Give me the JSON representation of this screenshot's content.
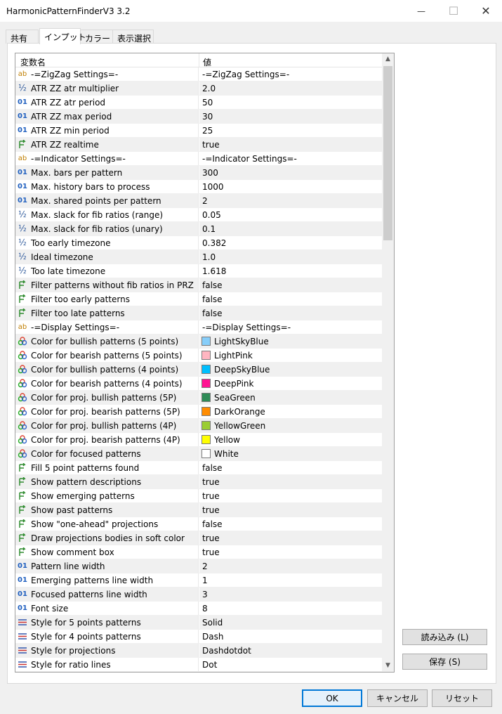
{
  "window": {
    "title": "HarmonicPatternFinderV3 3.2",
    "minimize_glyph": "—",
    "maximize_glyph": "☐",
    "close_glyph": "✕"
  },
  "tabs": [
    {
      "label": "共有"
    },
    {
      "label": "インプット"
    },
    {
      "label": "カラー"
    },
    {
      "label": "表示選択"
    }
  ],
  "grid": {
    "col_name": "変数名",
    "col_value": "値",
    "rows": [
      {
        "icon": "ab",
        "label": "-=ZigZag Settings=-",
        "value": "-=ZigZag Settings=-"
      },
      {
        "icon": "½",
        "label": "ATR ZZ atr multiplier",
        "value": "2.0"
      },
      {
        "icon": "01",
        "label": "ATR ZZ atr period",
        "value": "50"
      },
      {
        "icon": "01",
        "label": "ATR ZZ max period",
        "value": "30"
      },
      {
        "icon": "01",
        "label": "ATR ZZ min period",
        "value": "25"
      },
      {
        "icon": "bool",
        "label": "ATR ZZ realtime",
        "value": "true"
      },
      {
        "icon": "ab",
        "label": "-=Indicator Settings=-",
        "value": "-=Indicator Settings=-"
      },
      {
        "icon": "01",
        "label": "Max. bars per pattern",
        "value": "300"
      },
      {
        "icon": "01",
        "label": "Max. history bars to process",
        "value": "1000"
      },
      {
        "icon": "01",
        "label": "Max. shared points per pattern",
        "value": "2"
      },
      {
        "icon": "½",
        "label": "Max. slack for fib ratios (range)",
        "value": "0.05"
      },
      {
        "icon": "½",
        "label": "Max. slack for fib ratios (unary)",
        "value": "0.1"
      },
      {
        "icon": "½",
        "label": "Too early timezone",
        "value": "0.382"
      },
      {
        "icon": "½",
        "label": "Ideal timezone",
        "value": "1.0"
      },
      {
        "icon": "½",
        "label": "Too late timezone",
        "value": "1.618"
      },
      {
        "icon": "bool",
        "label": "Filter patterns without fib ratios in PRZ",
        "value": "false"
      },
      {
        "icon": "bool",
        "label": "Filter too early patterns",
        "value": "false"
      },
      {
        "icon": "bool",
        "label": "Filter too late patterns",
        "value": "false"
      },
      {
        "icon": "ab",
        "label": "-=Display Settings=-",
        "value": "-=Display Settings=-"
      },
      {
        "icon": "color",
        "label": "Color for bullish patterns (5 points)",
        "value": "LightSkyBlue",
        "swatch": "#87cefa"
      },
      {
        "icon": "color",
        "label": "Color for bearish patterns (5 points)",
        "value": "LightPink",
        "swatch": "#ffb6c1"
      },
      {
        "icon": "color",
        "label": "Color for bullish patterns (4 points)",
        "value": "DeepSkyBlue",
        "swatch": "#00bfff"
      },
      {
        "icon": "color",
        "label": "Color for bearish patterns (4 points)",
        "value": "DeepPink",
        "swatch": "#ff1493"
      },
      {
        "icon": "color",
        "label": "Color for proj. bullish patterns (5P)",
        "value": "SeaGreen",
        "swatch": "#2e8b57"
      },
      {
        "icon": "color",
        "label": "Color for proj. bearish patterns (5P)",
        "value": "DarkOrange",
        "swatch": "#ff8c00"
      },
      {
        "icon": "color",
        "label": "Color for proj. bullish patterns (4P)",
        "value": "YellowGreen",
        "swatch": "#9acd32"
      },
      {
        "icon": "color",
        "label": "Color for proj. bearish patterns (4P)",
        "value": "Yellow",
        "swatch": "#ffff00"
      },
      {
        "icon": "color",
        "label": "Color for focused patterns",
        "value": "White",
        "swatch": "#ffffff"
      },
      {
        "icon": "bool",
        "label": "Fill 5 point patterns found",
        "value": "false"
      },
      {
        "icon": "bool",
        "label": "Show pattern descriptions",
        "value": "true"
      },
      {
        "icon": "bool",
        "label": "Show emerging patterns",
        "value": "true"
      },
      {
        "icon": "bool",
        "label": "Show past patterns",
        "value": "true"
      },
      {
        "icon": "bool",
        "label": "Show \"one-ahead\" projections",
        "value": "false"
      },
      {
        "icon": "bool",
        "label": "Draw projections bodies in soft color",
        "value": "true"
      },
      {
        "icon": "bool",
        "label": "Show comment box",
        "value": "true"
      },
      {
        "icon": "01",
        "label": "Pattern line width",
        "value": "2"
      },
      {
        "icon": "01",
        "label": "Emerging patterns line width",
        "value": "1"
      },
      {
        "icon": "01",
        "label": "Focused patterns line width",
        "value": "3"
      },
      {
        "icon": "01",
        "label": "Font size",
        "value": "8"
      },
      {
        "icon": "style",
        "label": "Style for 5 points patterns",
        "value": "Solid"
      },
      {
        "icon": "style",
        "label": "Style for 4 points patterns",
        "value": "Dash"
      },
      {
        "icon": "style",
        "label": "Style for projections",
        "value": "Dashdotdot"
      },
      {
        "icon": "style",
        "label": "Style for ratio lines",
        "value": "Dot"
      }
    ]
  },
  "buttons": {
    "load": "読み込み (L)",
    "save": "保存 (S)",
    "ok": "OK",
    "cancel": "キャンセル",
    "reset": "リセット"
  }
}
